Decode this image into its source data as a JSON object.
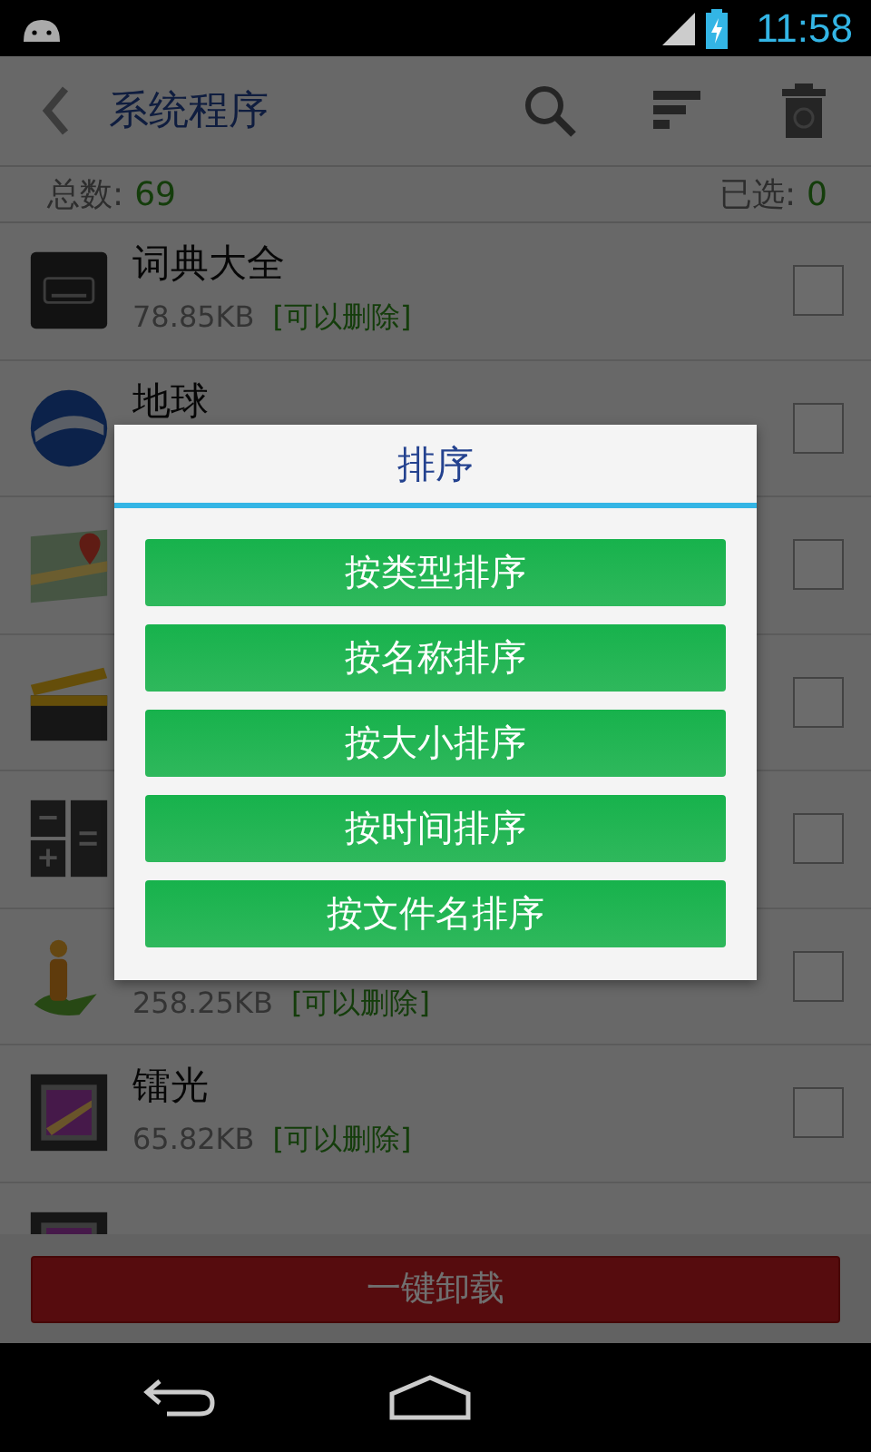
{
  "status_bar": {
    "time": "11:58"
  },
  "toolbar": {
    "title": "系统程序"
  },
  "summary": {
    "total_label": "总数:",
    "total": "69",
    "selected_label": "已选:",
    "selected": "0"
  },
  "apps": [
    {
      "name": "词典大全",
      "size": "78.85KB",
      "tag": "[可以删除]",
      "checked": false
    },
    {
      "name": "地球",
      "checked": false
    },
    {
      "checked": false
    },
    {
      "checked": false
    },
    {
      "checked": false
    },
    {
      "size": "258.25KB",
      "tag": "[可以删除]",
      "checked": false
    },
    {
      "name": "镭光",
      "size": "65.82KB",
      "tag": "[可以删除]",
      "checked": false
    }
  ],
  "uninstall_button": "一键卸载",
  "dialog": {
    "title": "排序",
    "options": [
      "按类型排序",
      "按名称排序",
      "按大小排序",
      "按时间排序",
      "按文件名排序"
    ]
  }
}
